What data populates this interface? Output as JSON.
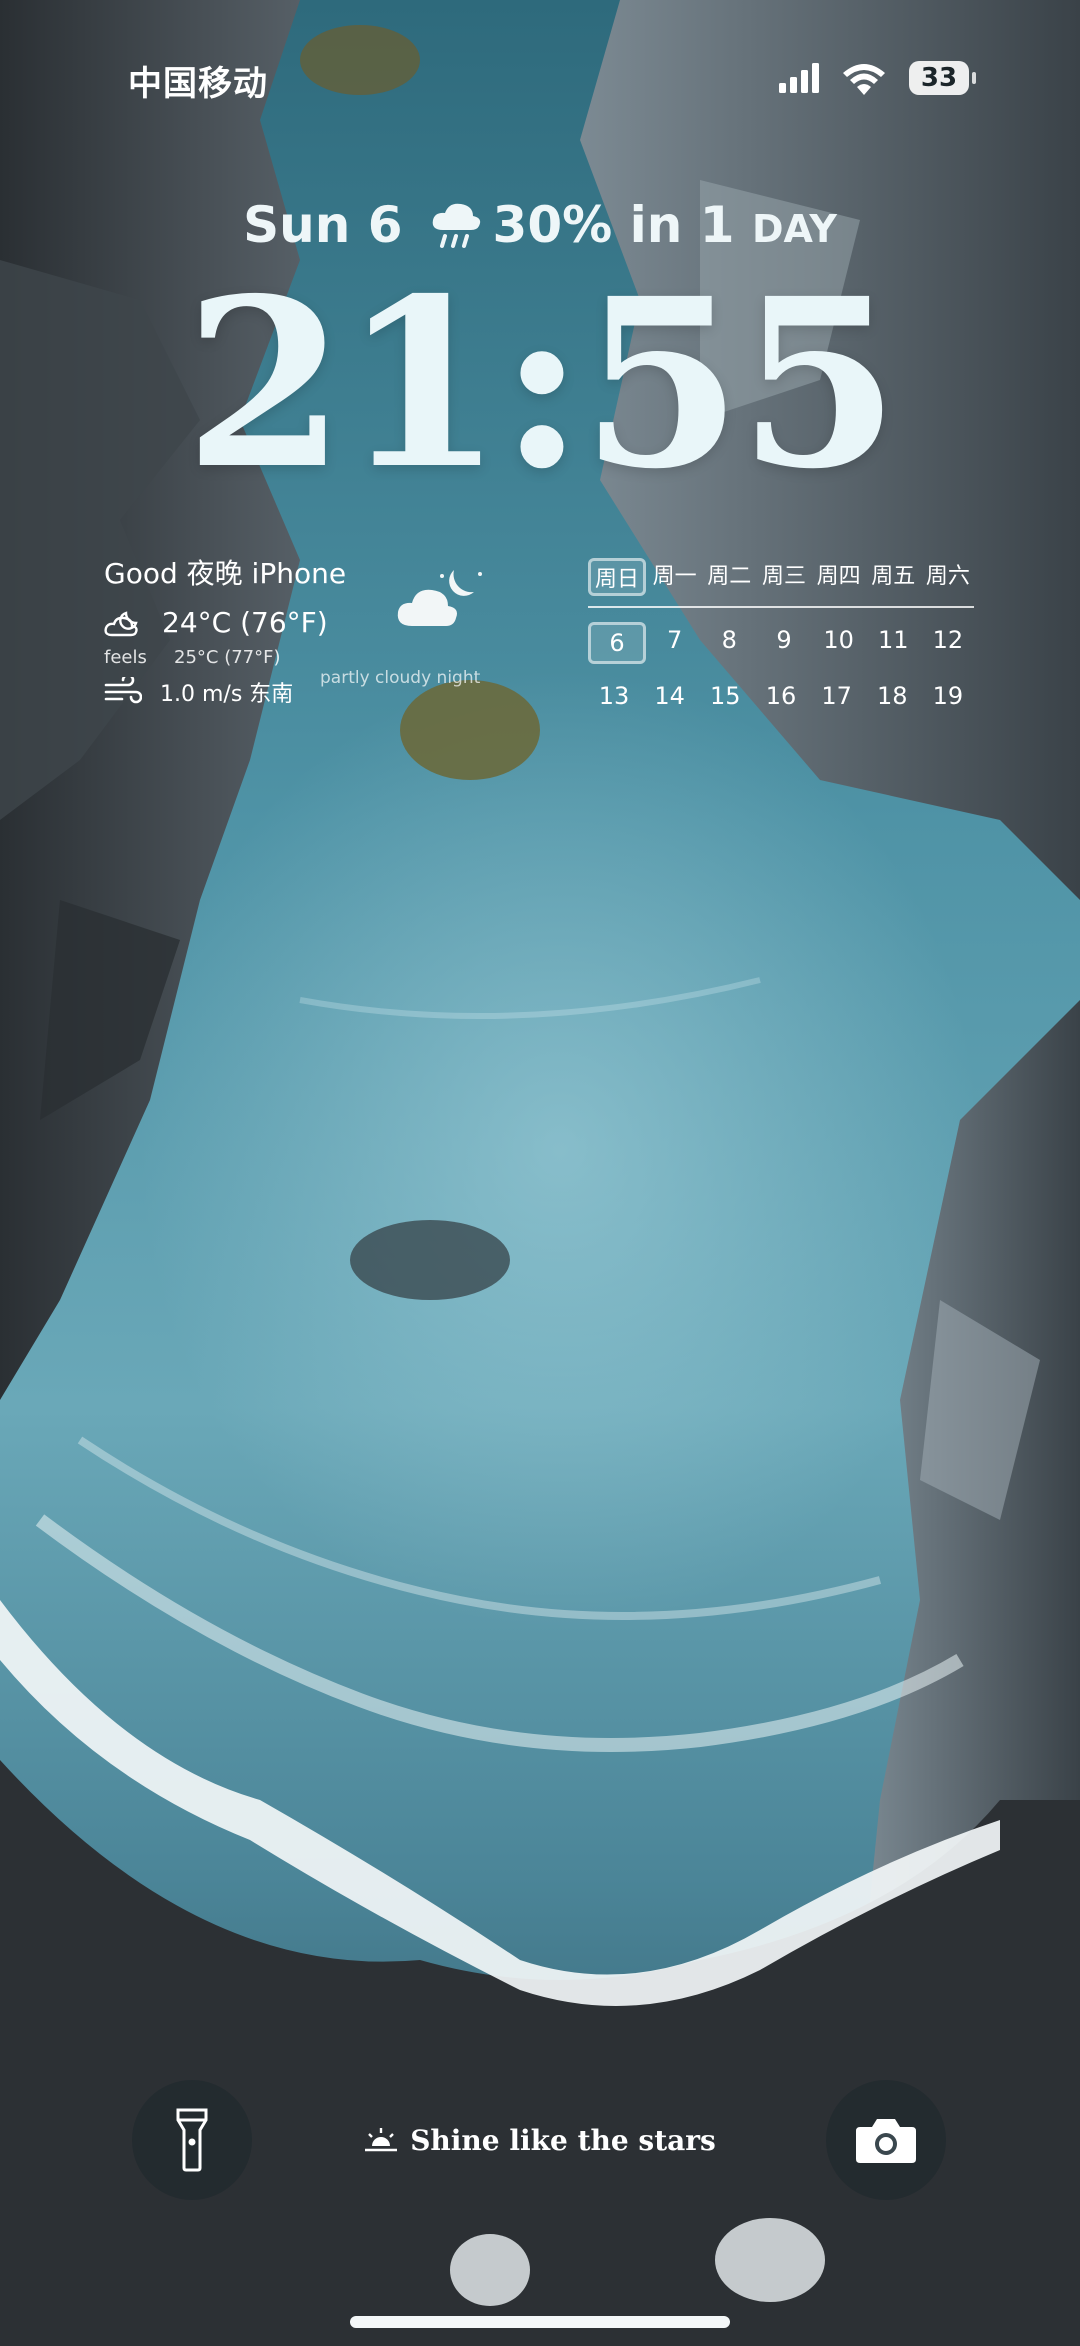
{
  "status_bar": {
    "carrier": "中国移动",
    "battery": "33",
    "icons": [
      "signal-icon",
      "wifi-icon",
      "battery-icon"
    ]
  },
  "date_line": {
    "date": "Sun 6",
    "rain_icon": "rain-cloud-icon",
    "forecast": "30% in 1",
    "unit": "DAY"
  },
  "clock": {
    "time": "21:55"
  },
  "weather": {
    "greeting": "Good 夜晚 iPhone",
    "temperature": "24°C (76°F)",
    "feels_label": "feels",
    "feels_value": "25°C (77°F)",
    "wind": "1.0 m/s 东南",
    "condition": "partly cloudy night",
    "condition_icon": "partly-cloudy-night-icon"
  },
  "calendar": {
    "weekdays": [
      "周日",
      "周一",
      "周二",
      "周三",
      "周四",
      "周五",
      "周六"
    ],
    "week1": [
      "6",
      "7",
      "8",
      "9",
      "10",
      "11",
      "12"
    ],
    "week2": [
      "13",
      "14",
      "15",
      "16",
      "17",
      "18",
      "19"
    ],
    "today": "6"
  },
  "tagline": {
    "text": "Shine like the stars",
    "icon": "sunrise-icon"
  },
  "bottom": {
    "left_icon": "flashlight-icon",
    "right_icon": "camera-icon"
  },
  "colors": {
    "water": "#5fa0b2",
    "rock": "#3a4146",
    "foam": "#f2f6f7",
    "sand": "#2b2f33"
  }
}
